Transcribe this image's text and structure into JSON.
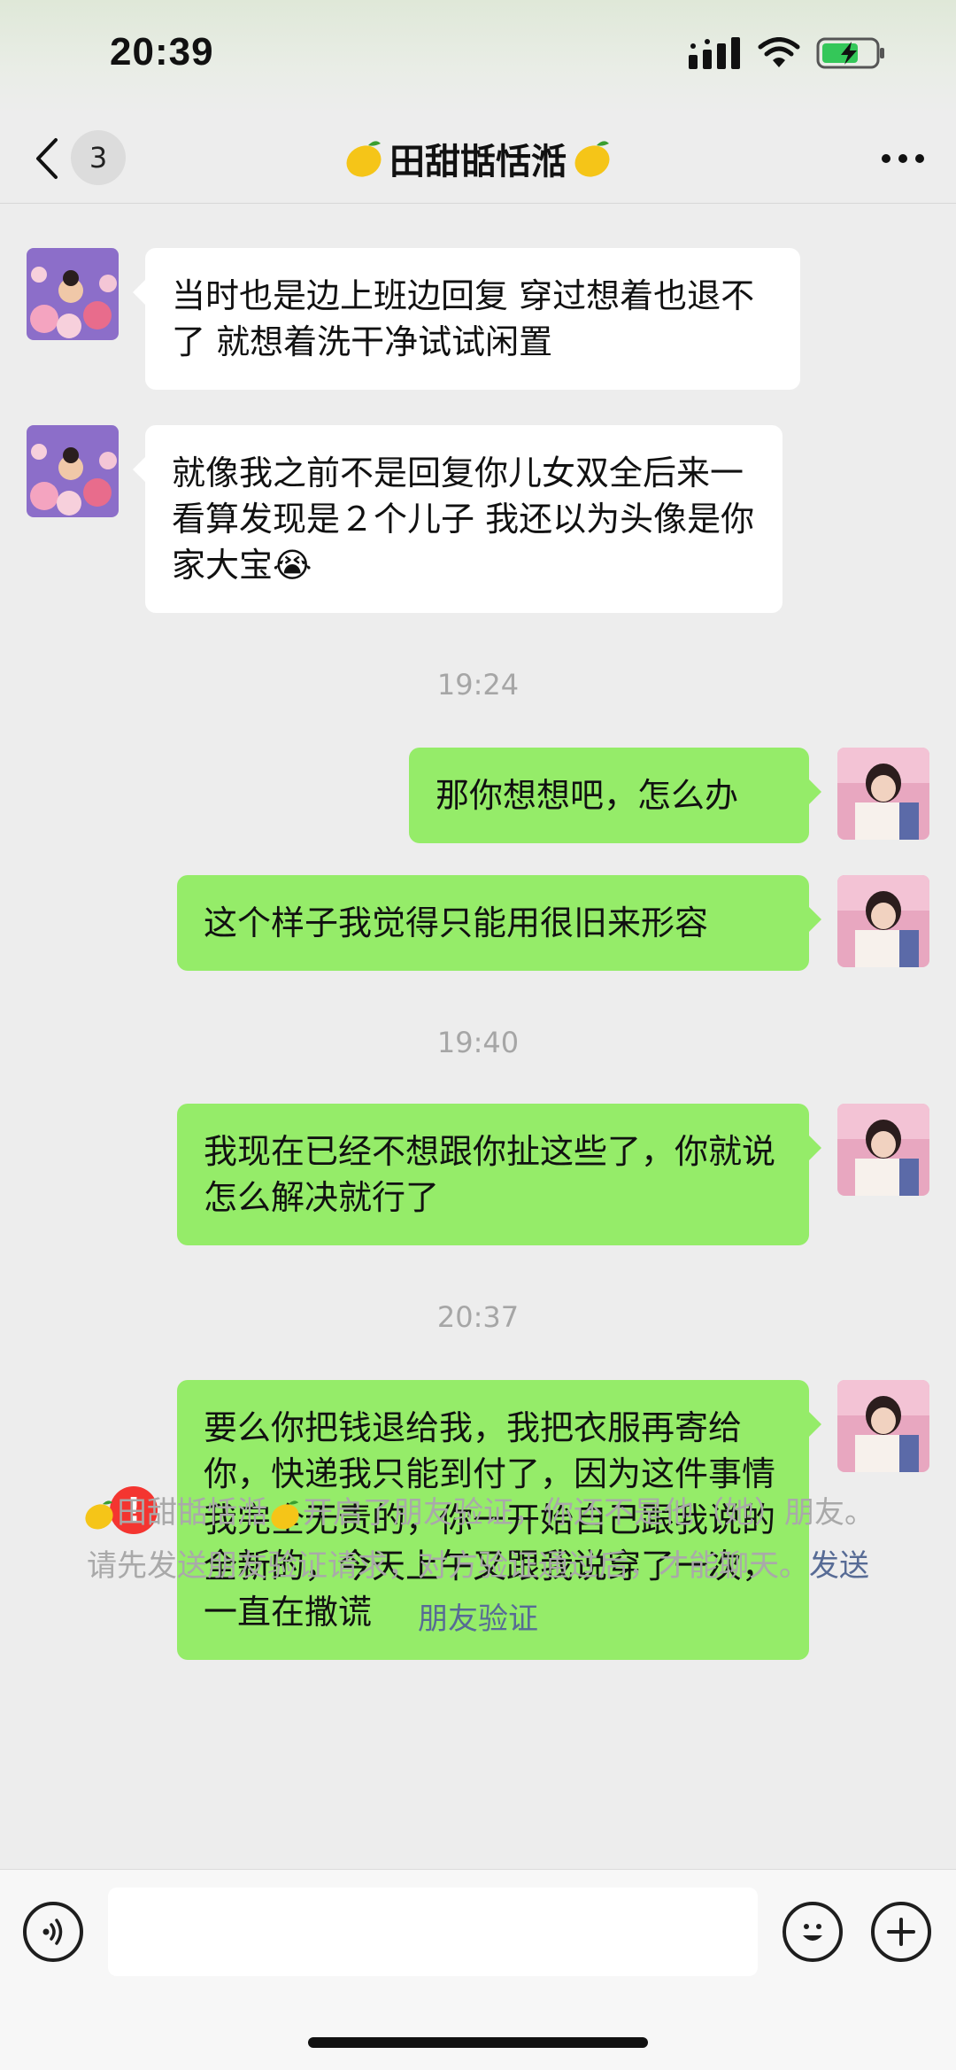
{
  "status_bar": {
    "time": "20:39"
  },
  "nav": {
    "unread_count": "3",
    "title": "田甜甛恬湉"
  },
  "messages": [
    {
      "side": "in",
      "text": "当时也是边上班边回复  穿过想着也退不了 就想着洗干净试试闲置"
    },
    {
      "side": "in",
      "text": "就像我之前不是回复你儿女双全后来一看算发现是２个儿子 我还以为头像是你家大宝😭"
    },
    {
      "timestamp": "19:24"
    },
    {
      "side": "out",
      "text": "那你想想吧，怎么办"
    },
    {
      "side": "out",
      "text": "这个样子我觉得只能用很旧来形容"
    },
    {
      "timestamp": "19:40"
    },
    {
      "side": "out",
      "text": "我现在已经不想跟你扯这些了，你就说怎么解决就行了"
    },
    {
      "timestamp": "20:37"
    },
    {
      "side": "out",
      "text": "要么你把钱退给我，我把衣服再寄给你，快递我只能到付了，因为这件事情我完全无责的，你一开始自己跟我说的全新的，今天上午又跟我说穿了一次，一直在撒谎",
      "failed": true
    }
  ],
  "system_notice": {
    "name": "田甜甛恬湉",
    "text": "开启了朋友验证，你还不是他（她）朋友。请先发送朋友验证请求，对方验证通过后，才能聊天。",
    "link": "发送朋友验证"
  },
  "input_bar": {
    "voice_icon": "voice-icon",
    "emoji_icon": "emoji-icon",
    "plus_icon": "plus-icon",
    "placeholder": ""
  },
  "colors": {
    "outgoing_bubble": "#95ec69",
    "incoming_bubble": "#ffffff",
    "background": "#ededed",
    "error": "#f43530",
    "link": "#576b95"
  }
}
